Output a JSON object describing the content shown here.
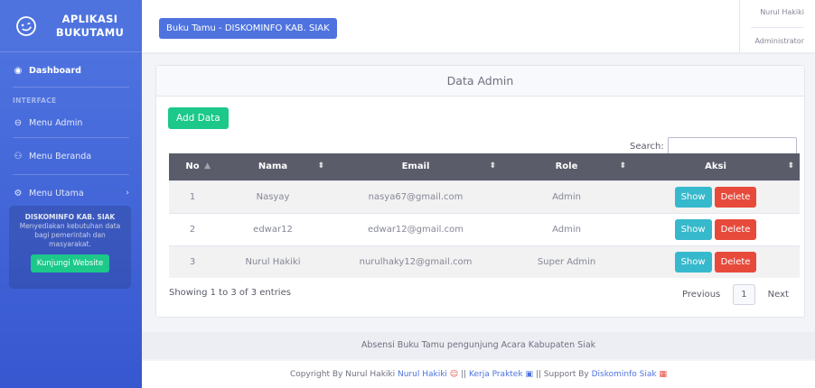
{
  "sidebar": {
    "brand": "APLIKASI BUKUTAMU",
    "brand_line1": "APLIKASI",
    "brand_line2": "BUKUTAMU",
    "dashboard": "Dashboard",
    "heading": "INTERFACE",
    "menu_admin": "Menu Admin",
    "menu_beranda": "Menu Beranda",
    "menu_utama": "Menu Utama",
    "promo_title": "DISKOMINFO KAB. SIAK",
    "promo_text": "Menyediakan kebutuhan data bagi pemerintah dan masyarakat.",
    "promo_button": "Kunjungi Website"
  },
  "topbar": {
    "title": "Buku Tamu - DISKOMINFO KAB. SIAK",
    "user_name": "Nurul Hakiki",
    "user_role": "Administrator"
  },
  "card": {
    "title": "Data Admin",
    "add_button": "Add Data",
    "search_label": "Search:",
    "search_value": ""
  },
  "table": {
    "headers": [
      "No",
      "Nama",
      "Email",
      "Role",
      "Aksi"
    ],
    "rows": [
      {
        "no": "1",
        "nama": "Nasyay",
        "email": "nasya67@gmail.com",
        "role": "Admin"
      },
      {
        "no": "2",
        "nama": "edwar12",
        "email": "edwar12@gmail.com",
        "role": "Admin"
      },
      {
        "no": "3",
        "nama": "Nurul Hakiki",
        "email": "nurulhaky12@gmail.com",
        "role": "Super Admin"
      }
    ],
    "show_label": "Show",
    "delete_label": "Delete"
  },
  "pagination": {
    "info": "Showing 1 to 3 of 3 entries",
    "previous": "Previous",
    "page": "1",
    "next": "Next"
  },
  "footer": {
    "line1": "Absensi Buku Tamu pengunjung Acara Kabupaten Siak",
    "copyright_prefix": "Copyright By Nurul Hakiki",
    "copyright_link": "Nurul Hakiki",
    "sep1": "||",
    "kerja_praktek": "Kerja Praktek",
    "sep2": "||",
    "support_prefix": "Support By",
    "support_link": "Diskominfo Siak"
  },
  "colors": {
    "primary": "#4e73df",
    "success": "#1cc88a",
    "info": "#36b9cc",
    "danger": "#e74a3b"
  }
}
